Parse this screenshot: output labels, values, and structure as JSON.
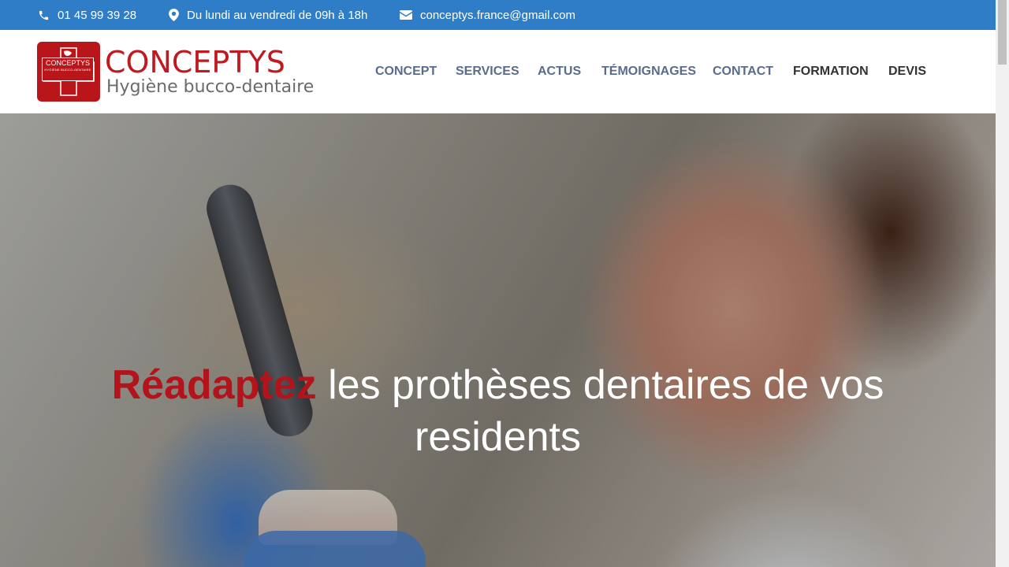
{
  "topbar": {
    "phone": "01 45 99 39 28",
    "hours": "Du lundi au vendredi de 09h à 18h",
    "email": "conceptys.france@gmail.com",
    "bg_color": "#2f7dc6"
  },
  "logo": {
    "title": "CONCEPTYS",
    "subtitle": "Hygiène bucco-dentaire",
    "badge_text": "CONCEPTYS",
    "badge_small": "HYGIÈNE BUCCO-DENTAIRE",
    "brand_color": "#c0191f"
  },
  "nav": {
    "items": [
      {
        "label": "CONCEPT",
        "color": "#5a6b8c"
      },
      {
        "label": "SERVICES",
        "color": "#5a6b8c"
      },
      {
        "label": "ACTUS",
        "color": "#5a6b8c"
      },
      {
        "label": "TÉMOIGNAGES",
        "color": "#5a6b8c"
      },
      {
        "label": "CONTACT",
        "color": "#5a6b8c"
      },
      {
        "label": "FORMATION",
        "color": "#333333"
      },
      {
        "label": "DEVIS",
        "color": "#333333"
      }
    ]
  },
  "hero": {
    "title_accent": "Réadaptez",
    "title_rest": " les prothèses dentaires de vos",
    "title_line2": "residents",
    "accent_color": "#b3131a"
  },
  "icons": {
    "phone": "phone-icon",
    "hours": "map-pin-icon",
    "email": "envelope-icon"
  }
}
